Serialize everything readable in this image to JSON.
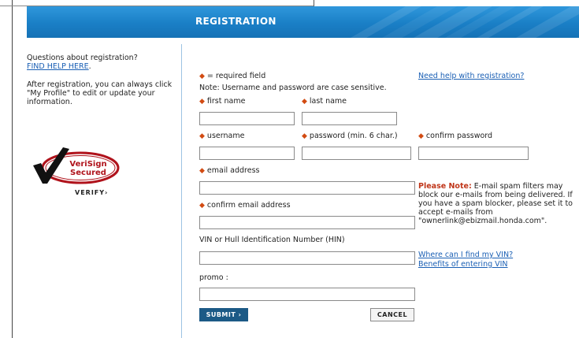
{
  "header": {
    "title": "REGISTRATION"
  },
  "sidebar": {
    "question": "Questions about registration?",
    "help_link": "FIND HELP HERE",
    "help_period": ".",
    "after_text_1": "After registration, you can always click",
    "after_text_2": "\"My Profile\" to edit or update your",
    "after_text_3": "information.",
    "seal_line1": "VeriSign",
    "seal_line2": "Secured",
    "seal_verify": "VERIFY›"
  },
  "form": {
    "required_note": "= required field",
    "case_note": "Note: Username and password are case sensitive.",
    "help_link": "Need help with registration?",
    "first_name_label": "first name",
    "last_name_label": "last name",
    "username_label": "username",
    "password_label": "password (min. 6 char.)",
    "confirm_password_label": "confirm password",
    "email_label": "email address",
    "confirm_email_label": "confirm email address",
    "vin_label": "VIN or Hull Identification Number (HIN)",
    "promo_label": "promo :",
    "vin_link": "Where can I find my VIN?",
    "benefits_link": "Benefits of entering VIN",
    "spam_note_title": "Please Note:",
    "spam_note_body": " E-mail spam filters may block our e-mails from being delivered. If you have a spam blocker, please set it to accept e-mails from \"ownerlink@ebizmail.honda.com\".",
    "submit_label": "SUBMIT ›",
    "cancel_label": "CANCEL"
  },
  "colors": {
    "header_blue": "#1a7fc6",
    "link_blue": "#1a5fb4",
    "required_orange": "#d24b12",
    "note_red": "#c0361a",
    "submit_navy": "#1c5a86"
  }
}
